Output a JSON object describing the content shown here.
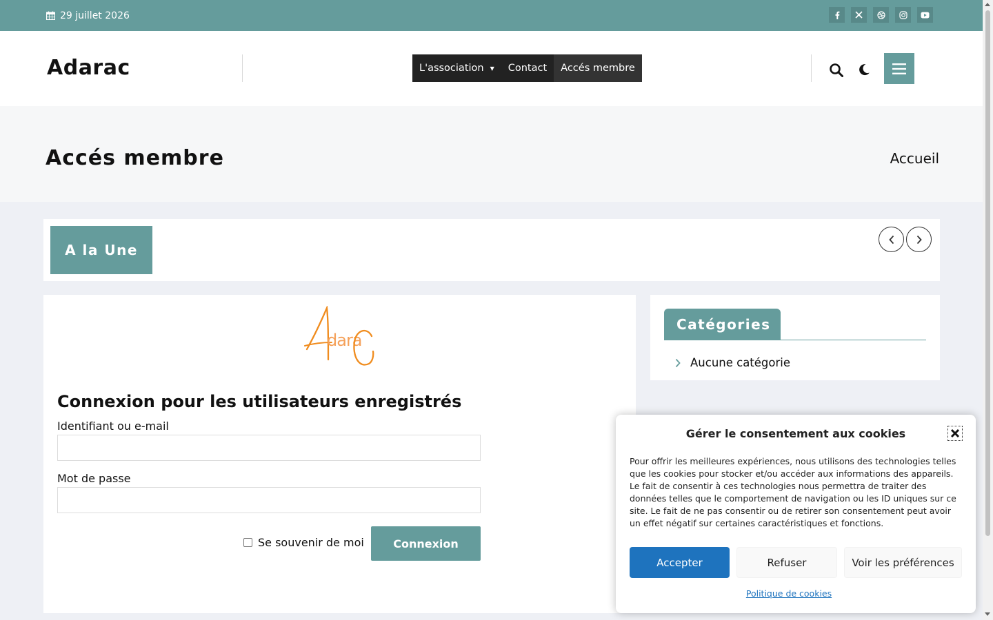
{
  "topbar": {
    "date": "29 juillet 2026",
    "date_icon": "calendar-icon",
    "socials": [
      "facebook-icon",
      "x-twitter-icon",
      "dribbble-icon",
      "instagram-icon",
      "youtube-icon"
    ]
  },
  "header": {
    "brand": "Adarac",
    "nav": [
      {
        "label": "L'association",
        "has_dropdown": true
      },
      {
        "label": "Contact"
      },
      {
        "label": "Accés membre",
        "active": true
      }
    ],
    "icons": [
      "search-icon",
      "moon-icon",
      "hamburger-menu-icon"
    ]
  },
  "titleband": {
    "title": "Accés membre",
    "breadcrumb": "Accueil"
  },
  "featured": {
    "label": "A la Une",
    "prev_icon": "chevron-left-icon",
    "next_icon": "chevron-right-icon"
  },
  "main": {
    "logo_text": "AdaraC",
    "title": "Connexion pour les utilisateurs enregistrés",
    "username_label": "Identifiant ou e-mail",
    "username_value": "",
    "password_label": "Mot de passe",
    "password_value": "",
    "remember_label": "Se souvenir de moi",
    "remember_checked": false,
    "submit_label": "Connexion"
  },
  "sidebar": {
    "heading": "Catégories",
    "items": [
      "Aucune catégorie"
    ]
  },
  "cookie": {
    "title": "Gérer le consentement aux cookies",
    "text": "Pour offrir les meilleures expériences, nous utilisons des technologies telles que les cookies pour stocker et/ou accéder aux informations des appareils. Le fait de consentir à ces technologies nous permettra de traiter des données telles que le comportement de navigation ou les ID uniques sur ce site. Le fait de ne pas consentir ou de retirer son consentement peut avoir un effet négatif sur certaines caractéristiques et fonctions.",
    "accept": "Accepter",
    "deny": "Refuser",
    "prefs": "Voir les préférences",
    "policy_link": "Politique de cookies"
  },
  "colors": {
    "accent": "#659c9c",
    "nav_bg": "#222222",
    "accept_blue": "#1e73be",
    "logo_orange": "#f08c1e"
  }
}
